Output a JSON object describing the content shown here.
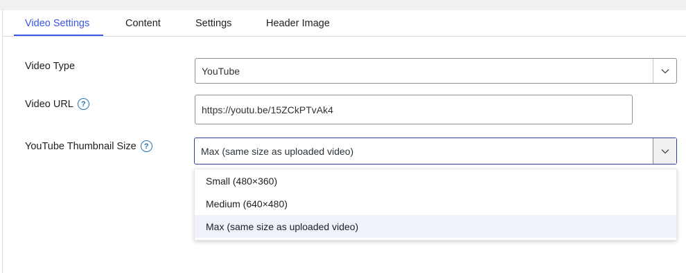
{
  "tabs": [
    {
      "label": "Video Settings",
      "active": true
    },
    {
      "label": "Content",
      "active": false
    },
    {
      "label": "Settings",
      "active": false
    },
    {
      "label": "Header Image",
      "active": false
    }
  ],
  "form": {
    "video_type": {
      "label": "Video Type",
      "value": "YouTube"
    },
    "video_url": {
      "label": "Video URL",
      "value": "https://youtu.be/15ZCkPTvAk4",
      "help": "?"
    },
    "thumbnail_size": {
      "label": "YouTube Thumbnail Size",
      "help": "?",
      "value": "Max (same size as uploaded video)",
      "options": [
        "Small (480×360)",
        "Medium (640×480)",
        "Max (same size as uploaded video)"
      ],
      "selected_index": 2
    }
  },
  "icons": {
    "help": "help-circle-icon",
    "chevron": "chevron-down-icon"
  },
  "colors": {
    "accent": "#3858e9",
    "help": "#2271b1",
    "selected_option_bg": "#f0f2fb"
  }
}
